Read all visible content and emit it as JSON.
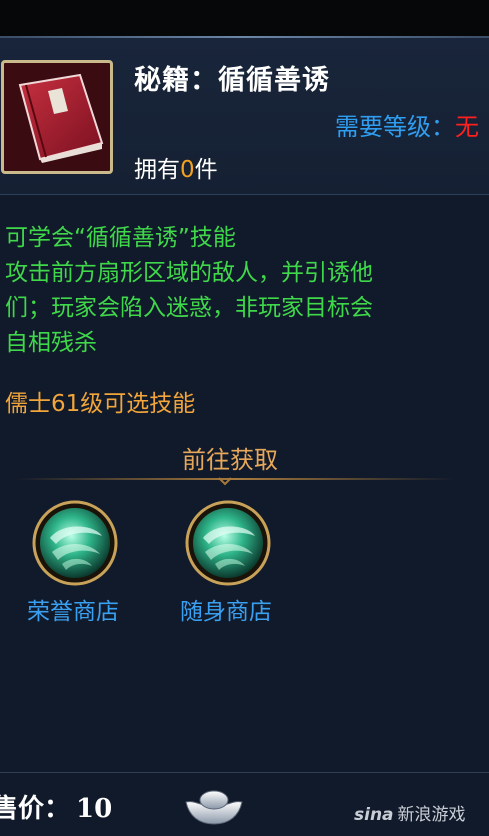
{
  "item": {
    "title": "秘籍：循循善诱",
    "required_level_label": "需要等级：",
    "required_level_value": "无",
    "own_prefix": "拥有",
    "own_count": "0",
    "own_suffix": "件",
    "icon": "red-skill-book-icon"
  },
  "description": {
    "lines": [
      "可学会“循循善诱”技能",
      "攻击前方扇形区域的敌人，并引诱他",
      "们；玩家会陷入迷惑，非玩家目标会",
      "自相残杀"
    ]
  },
  "class_requirement": "儒士61级可选技能",
  "obtain": {
    "title": "前往获取",
    "shops": [
      {
        "label": "荣誉商店",
        "icon": "green-vortex-icon"
      },
      {
        "label": "随身商店",
        "icon": "green-vortex-icon"
      }
    ]
  },
  "price": {
    "label": "售价：",
    "value": "10",
    "currency_icon": "silver-ingot-icon"
  },
  "watermark": {
    "logo": "sina",
    "text": "新浪游戏"
  },
  "colors": {
    "background": "#111a2a",
    "description_green": "#3fd84a",
    "class_orange": "#f2a53a",
    "shop_blue": "#39a0f2",
    "level_red": "#ff2020",
    "level_label_blue": "#2f9ef0",
    "count_orange": "#f4a020"
  }
}
